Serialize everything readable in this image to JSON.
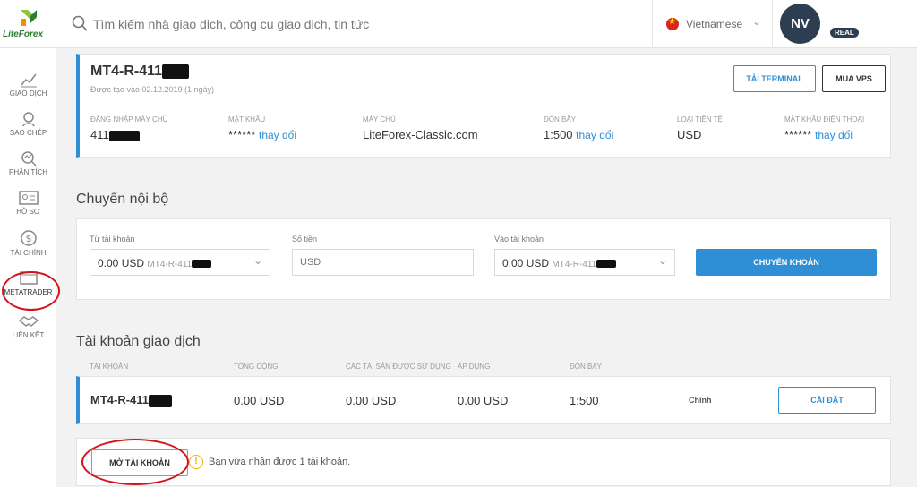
{
  "brand": {
    "name": "LiteForex"
  },
  "search": {
    "placeholder": "Tìm kiếm nhà giao dịch, công cụ giao dịch, tin tức"
  },
  "language": {
    "label": "Vietnamese"
  },
  "user": {
    "initials": "NV",
    "badge": "REAL"
  },
  "sidebar": {
    "items": [
      {
        "label": "GIAO DỊCH",
        "icon": "chart-icon"
      },
      {
        "label": "SAO CHÉP",
        "icon": "copy-trade-icon"
      },
      {
        "label": "PHÂN TÍCH",
        "icon": "analysis-icon"
      },
      {
        "label": "HỒ SƠ",
        "icon": "profile-icon"
      },
      {
        "label": "TÀI CHÍNH",
        "icon": "dollar-icon"
      },
      {
        "label": "METATRADER",
        "icon": "monitor-icon"
      },
      {
        "label": "LIÊN KẾT",
        "icon": "handshake-icon"
      }
    ]
  },
  "account": {
    "name": "MT4-R-411",
    "created": "Được tạo vào 02.12.2019 (1 ngày)",
    "btn_terminal": "TẢI TERMINAL",
    "btn_vps": "MUA VPS",
    "fields": [
      {
        "caption": "ĐĂNG NHẬP MÁY CHỦ",
        "value": "411",
        "link": ""
      },
      {
        "caption": "MẬT KHẨU",
        "value": "******",
        "link": "thay đổi"
      },
      {
        "caption": "MÁY CHỦ",
        "value": "LiteForex-Classic.com",
        "link": ""
      },
      {
        "caption": "ĐÒN BẨY",
        "value": "1:500",
        "link": "thay đổi"
      },
      {
        "caption": "LOẠI TIỀN TỆ",
        "value": "USD",
        "link": ""
      },
      {
        "caption": "MẬT KHẨU ĐIỆN THOẠI",
        "value": "******",
        "link": "thay đổi"
      }
    ]
  },
  "transfer": {
    "title": "Chuyển nội bộ",
    "from_label": "Từ tài khoản",
    "from_value": "0.00 USD",
    "from_account": "MT4-R-411",
    "amount_label": "Số tiền",
    "amount_placeholder": "USD",
    "to_label": "Vào tài khoản",
    "to_value": "0.00 USD",
    "to_account": "MT4-R-411",
    "button": "CHUYỂN KHOẢN"
  },
  "trading": {
    "title": "Tài khoản giao dịch",
    "headers": [
      "TÀI KHOẢN",
      "TỔNG CỘNG",
      "CÁC TÀI SẢN ĐƯỢC SỬ DỤNG",
      "ÁP DỤNG",
      "ĐÒN BẨY"
    ],
    "row": {
      "account": "MT4-R-411",
      "total": "0.00 USD",
      "used": "0.00 USD",
      "applied": "0.00 USD",
      "leverage": "1:500",
      "type": "Chính",
      "button": "CÀI ĐẶT"
    }
  },
  "open_account": {
    "button": "MỞ TÀI KHOẢN",
    "notice": "Bạn vừa nhận được 1 tài khoản."
  },
  "colors": {
    "accent": "#2f8fd6",
    "annotation": "#d4141c",
    "brand": "#2f7d32",
    "avatar": "#2c3e50"
  }
}
